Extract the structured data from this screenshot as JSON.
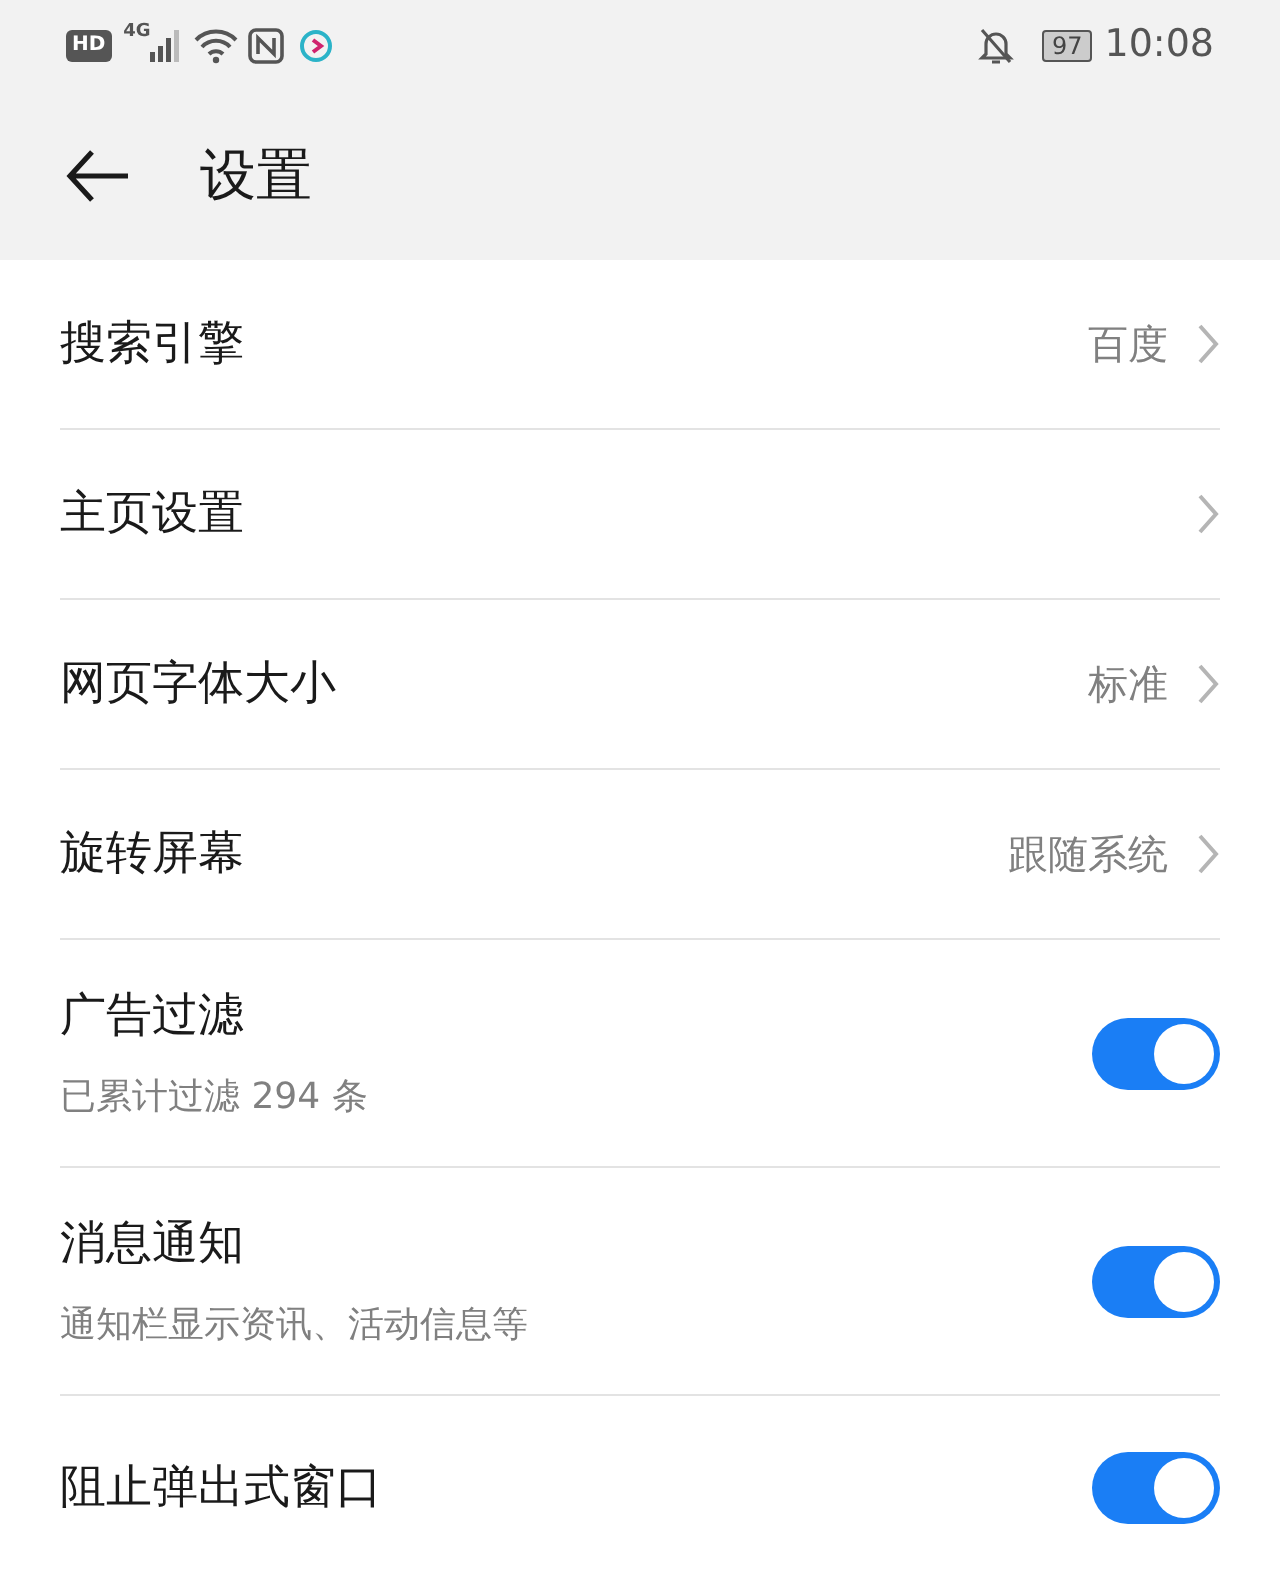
{
  "status_bar": {
    "hd_badge": "HD",
    "network": "4G",
    "battery": "97",
    "time": "10:08"
  },
  "header": {
    "title": "设置"
  },
  "items": [
    {
      "kind": "link",
      "label": "搜索引擎",
      "value": "百度"
    },
    {
      "kind": "link",
      "label": "主页设置"
    },
    {
      "kind": "link",
      "label": "网页字体大小",
      "value": "标准"
    },
    {
      "kind": "link",
      "label": "旋转屏幕",
      "value": "跟随系统"
    },
    {
      "kind": "toggle",
      "label": "广告过滤",
      "description": "已累计过滤 294 条",
      "on": true
    },
    {
      "kind": "toggle",
      "label": "消息通知",
      "description": "通知栏显示资讯、活动信息等",
      "on": true
    },
    {
      "kind": "toggle",
      "label": "阻止弹出式窗口",
      "on": true
    }
  ]
}
